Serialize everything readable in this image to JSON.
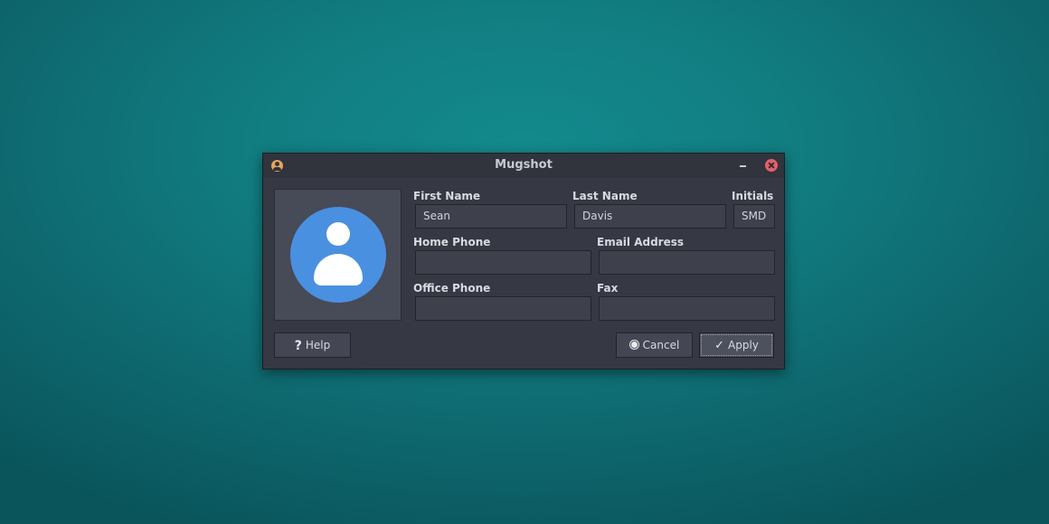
{
  "window": {
    "title": "Mugshot",
    "app_icon": "user-circle-icon"
  },
  "avatar": {
    "icon": "user-avatar-icon",
    "color": "#4a90e0"
  },
  "form": {
    "first_name": {
      "label": "First Name",
      "value": "Sean"
    },
    "last_name": {
      "label": "Last Name",
      "value": "Davis"
    },
    "initials": {
      "label": "Initials",
      "value": "SMD"
    },
    "home_phone": {
      "label": "Home Phone",
      "value": ""
    },
    "email_address": {
      "label": "Email Address",
      "value": ""
    },
    "office_phone": {
      "label": "Office Phone",
      "value": ""
    },
    "fax": {
      "label": "Fax",
      "value": ""
    }
  },
  "buttons": {
    "help": {
      "label": "Help",
      "icon": "question-mark-icon"
    },
    "cancel": {
      "label": "Cancel",
      "icon": "cancel-icon"
    },
    "apply": {
      "label": "Apply",
      "icon": "checkmark-icon"
    }
  },
  "colors": {
    "close_button": "#e0616b",
    "app_icon": "#e5a65c"
  }
}
